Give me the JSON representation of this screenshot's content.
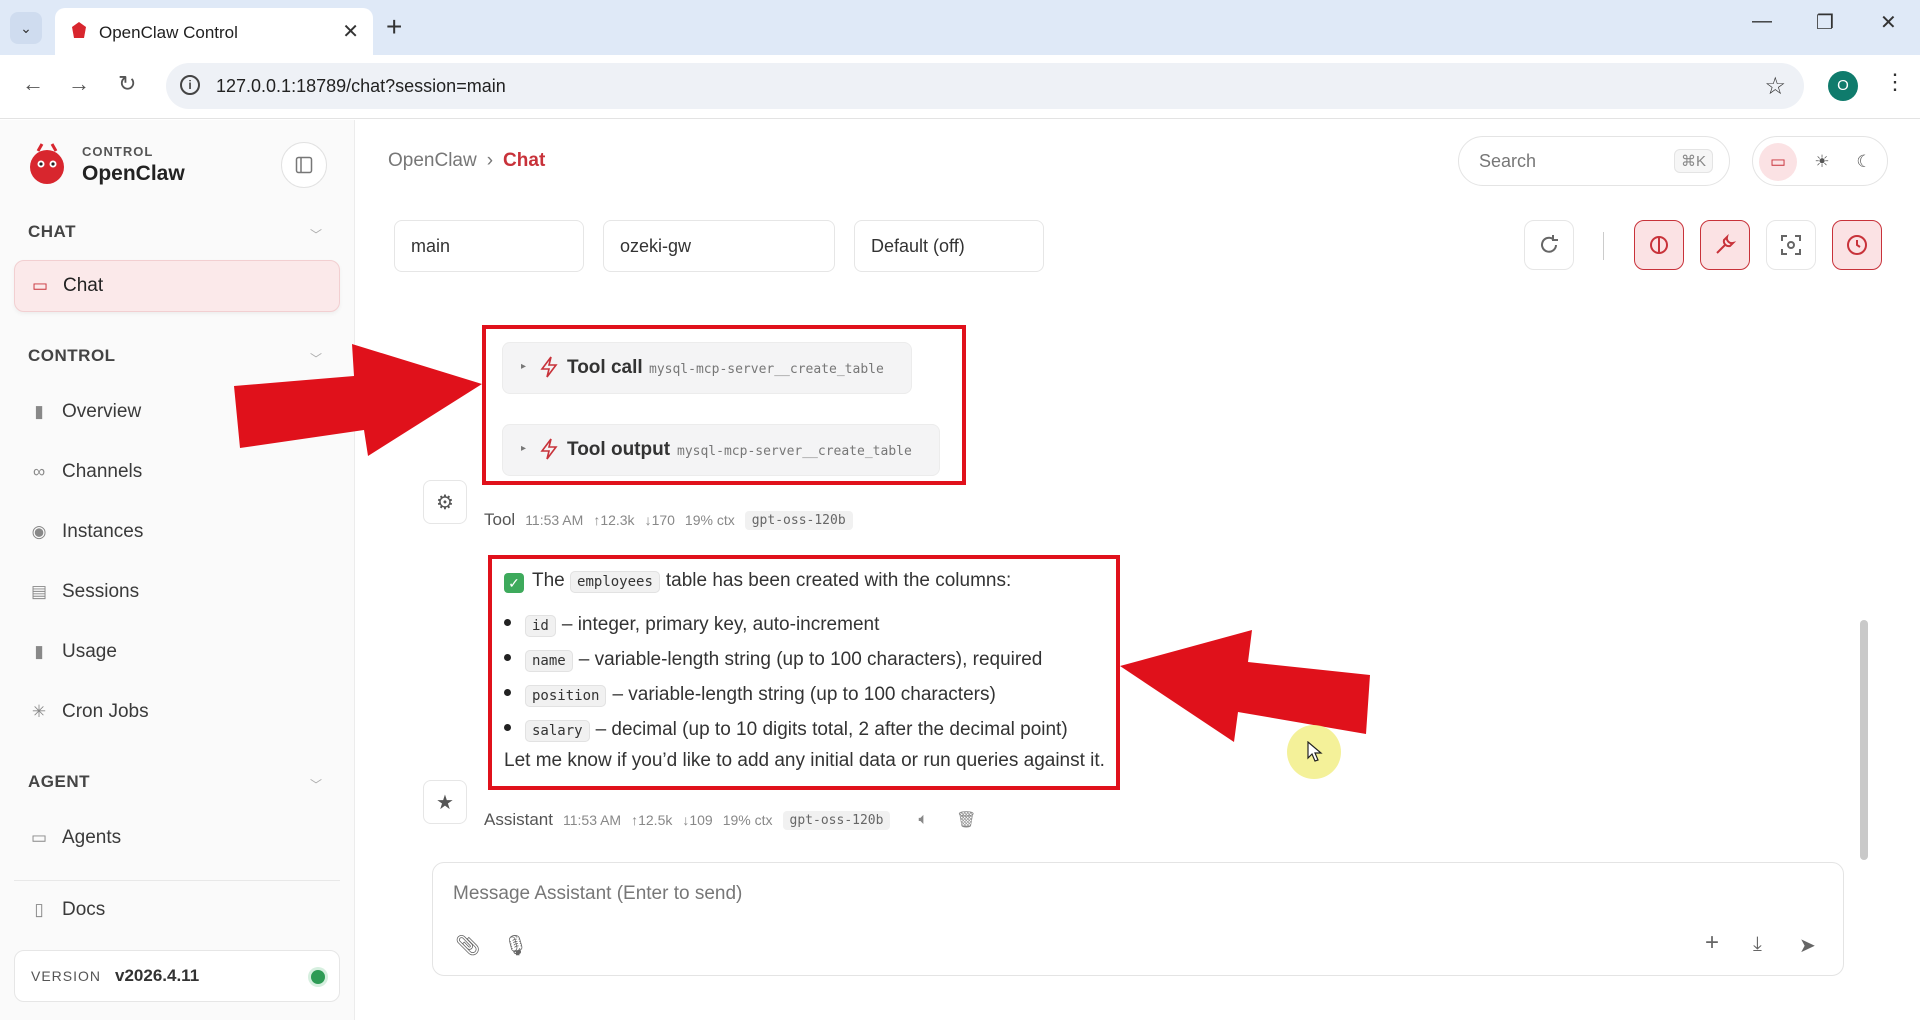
{
  "browser": {
    "tab_title": "OpenClaw Control",
    "url": "127.0.0.1:18789/chat?session=main",
    "profile_initial": "O"
  },
  "sidebar": {
    "brand_kicker": "CONTROL",
    "brand_name": "OpenClaw",
    "sections": {
      "chat": "CHAT",
      "control": "CONTROL",
      "agent": "AGENT"
    },
    "items": {
      "chat": "Chat",
      "overview": "Overview",
      "channels": "Channels",
      "instances": "Instances",
      "sessions": "Sessions",
      "usage": "Usage",
      "cron_jobs": "Cron Jobs",
      "agents": "Agents",
      "docs": "Docs"
    },
    "version_label": "VERSION",
    "version_value": "v2026.4.11"
  },
  "header": {
    "breadcrumb_root": "OpenClaw",
    "breadcrumb_current": "Chat",
    "search_placeholder": "Search",
    "search_shortcut": "⌘K"
  },
  "session_bar": {
    "session": "main",
    "gateway": "ozeki-gw",
    "thinking": "Default (off)"
  },
  "messages": {
    "tool_call": {
      "label": "Tool call",
      "name": "mysql-mcp-server__create_table"
    },
    "tool_output": {
      "label": "Tool output",
      "name": "mysql-mcp-server__create_table"
    },
    "tool_meta": {
      "sender": "Tool",
      "time": "11:53 AM",
      "tokens_in": "↑12.3k",
      "tokens_out": "↓170",
      "ctx": "19% ctx",
      "model": "gpt-oss-120b"
    },
    "assistant": {
      "intro_pre": "The",
      "intro_code": "employees",
      "intro_post": "table has been created with the columns:",
      "columns": [
        {
          "code": "id",
          "text": "– integer, primary key, auto-increment"
        },
        {
          "code": "name",
          "text": "– variable-length string (up to 100 characters), required"
        },
        {
          "code": "position",
          "text": "– variable-length string (up to 100 characters)"
        },
        {
          "code": "salary",
          "text": "– decimal (up to 10 digits total, 2 after the decimal point)"
        }
      ],
      "closing": "Let me know if you’d like to add any initial data or run queries against it."
    },
    "assistant_meta": {
      "sender": "Assistant",
      "time": "11:53 AM",
      "tokens_in": "↑12.5k",
      "tokens_out": "↓109",
      "ctx": "19% ctx",
      "model": "gpt-oss-120b"
    }
  },
  "composer": {
    "placeholder": "Message Assistant (Enter to send)"
  },
  "colors": {
    "accent": "#c8323a",
    "annotation_red": "#e0111b",
    "status_green": "#2e9b55"
  }
}
